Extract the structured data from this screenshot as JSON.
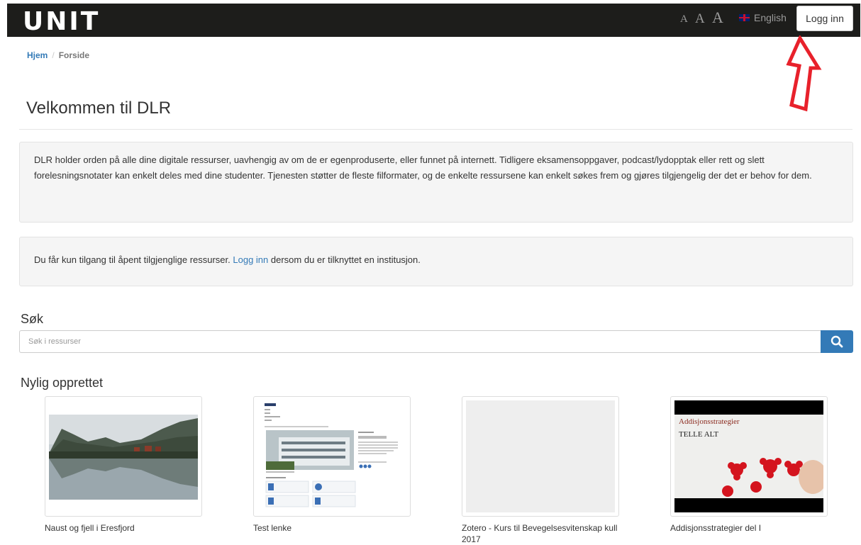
{
  "header": {
    "logo": "UNIT",
    "font_sizes": [
      "A",
      "A",
      "A"
    ],
    "language": "English",
    "login_label": "Logg inn"
  },
  "breadcrumb": {
    "home": "Hjem",
    "separator": "/",
    "current": "Forside"
  },
  "page_title": "Velkommen til DLR",
  "intro_text": "DLR holder orden på alle dine digitale ressurser, uavhengig av om de er egenproduserte, eller funnet på internett. Tidligere eksamensoppgaver, podcast/lydopptak eller rett og slett forelesningsnotater kan enkelt deles med dine studenter. Tjenesten støtter de fleste filformater, og de enkelte ressursene kan enkelt søkes frem og gjøres tilgjengelig der det er behov for dem.",
  "access_notice": {
    "before": "Du får kun tilgang til åpent tilgjenglige ressurser. ",
    "link": "Logg inn",
    "after": " dersom du er tilknyttet en institusjon."
  },
  "search": {
    "heading": "Søk",
    "placeholder": "Søk i ressurser"
  },
  "recent": {
    "heading": "Nylig opprettet",
    "items": [
      {
        "label": "Naust og fjell i Eresfjord"
      },
      {
        "label": "Test lenke"
      },
      {
        "label": "Zotero - Kurs til Bevegelsesvitenskap kull 2017"
      },
      {
        "label": "Addisjonsstrategier del I",
        "thumb_line1": "Addisjonsstrategier",
        "thumb_line2": "TELLE ALT"
      }
    ]
  },
  "colors": {
    "topbar": "#1d1d1b",
    "link": "#337ab7",
    "annotation_arrow": "#e8212b"
  }
}
